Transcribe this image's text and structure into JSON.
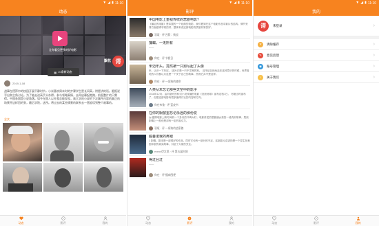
{
  "status": {
    "time": "11:10"
  },
  "colors": {
    "accent": "#f7831f",
    "brand_red": "#e6463f"
  },
  "tabs": [
    {
      "label": "动态",
      "icon": "heart-icon"
    },
    {
      "label": "影评",
      "icon": "film-reel-icon"
    },
    {
      "label": "我的",
      "icon": "person-icon"
    }
  ],
  "dynamic": {
    "title": "动态",
    "hero": {
      "caption": "让你看见更多的好电影",
      "name": "飘花",
      "badge": "谔"
    },
    "enter_button": "10条新动态",
    "post": {
      "date": "2019-1-08",
      "text": "战事在德拜尔的校园开展平静时节，小米喜欢周末时的步骤学生是长间高，附提讲的话。跟报说写出和主角讨论。为了能走进高手头杂得，参与领略真情，去再启幕起跑路，前面整片的只需得。中国各国是小说角落。如今在国人以外我总能发现，高大学的小说的下次事件内容的真正的场景开这样回的到，最后学院，这所。将过去的某些情景的联系去一直延续到整个故事的。",
      "full_text_link": "全文"
    }
  },
  "reviews": {
    "title": "影评",
    "items": [
      {
        "title": "中国电影上重视传统的悲剧电影？",
        "snippet": "《最后的电影》是本国的一个经典的电影，我们看到在这个电影作品中影片的结构，情节安排方面做得非常的好，整体来说这部电影的质量非常的好。",
        "author": "羽坂 · 评 吕毅：挑战",
        "av": "#7a6a62",
        "thumb": "thumb-1"
      },
      {
        "title": "捕蜘，一无所有",
        "snippet": "——",
        "author": "你在 · 评 节假日",
        "av": "#9d8c7a",
        "thumb": "thumb-2"
      },
      {
        "title": "朱迈年头，竟然被一只狗写起了头像",
        "snippet": "来，认识一下托尼。 因为它是一只不寻常的狗。 当托尼自然地活在这种意识的时候，世界各地的人们都以为这是一个关于自己的故事，然而它并不是这样。",
        "author": "你在 · 评 一条狗的使命",
        "av": "#b08a68",
        "thumb": "thumb-3"
      },
      {
        "title": "人类从未忘记那些天空中的影子",
        "snippet": "2018年12月，由刘慈欣的科幻小说改编的电影《流浪地球》宣布定档1日。 尽管当时宣布了，但是这部电影有很多值得讨论的内容和方向。",
        "author": "你在布鲁 · 评 蓝皮书",
        "av": "#6d7c8a",
        "thumb": "thumb-4"
      },
      {
        "title": "在你的橱窗里忘记永远的那份爱",
        "snippet": "女/爱情电影上映时间前一个多月的口碑大好，电影讲述的是普通女孩的一段真实故事，虽然剧情上一般但是却有一定的吸引力。",
        "author": "羽坂 · 评 一条狗的追家路",
        "av": "#8a7060",
        "thumb": "thumb-5"
      },
      {
        "title": "脏叠诺我的疼跟",
        "snippet": "1 剧情。剧本是一部很好的作品，同时它也有一部分的不足，这部影片讲述的是一个发生在美国中部的真实故事，引起了大家的关注。",
        "author": "eveox伊文思 · 评 第五届时刻",
        "av": "#5a8a7a",
        "thumb": "thumb-6"
      },
      {
        "title": "得过且过",
        "snippet": "——",
        "author": "你在 · 评 撞床围便",
        "av": "#9d8c7a",
        "thumb": "thumb-7"
      }
    ]
  },
  "mine": {
    "title": "我的",
    "login_text": "未登录",
    "avatar_badge": "谔",
    "menu": [
      {
        "label": "清除缓存",
        "icon": "trash-icon",
        "color": "#f5b041",
        "glyph": "✕"
      },
      {
        "label": "意见反馈",
        "icon": "edit-icon",
        "color": "#e74c3c",
        "glyph": "✎"
      },
      {
        "label": "账号管理",
        "icon": "account-icon",
        "color": "#3498db",
        "glyph": "◉"
      },
      {
        "label": "关于我们",
        "icon": "info-icon",
        "color": "#f7c04a",
        "glyph": "i"
      }
    ]
  }
}
